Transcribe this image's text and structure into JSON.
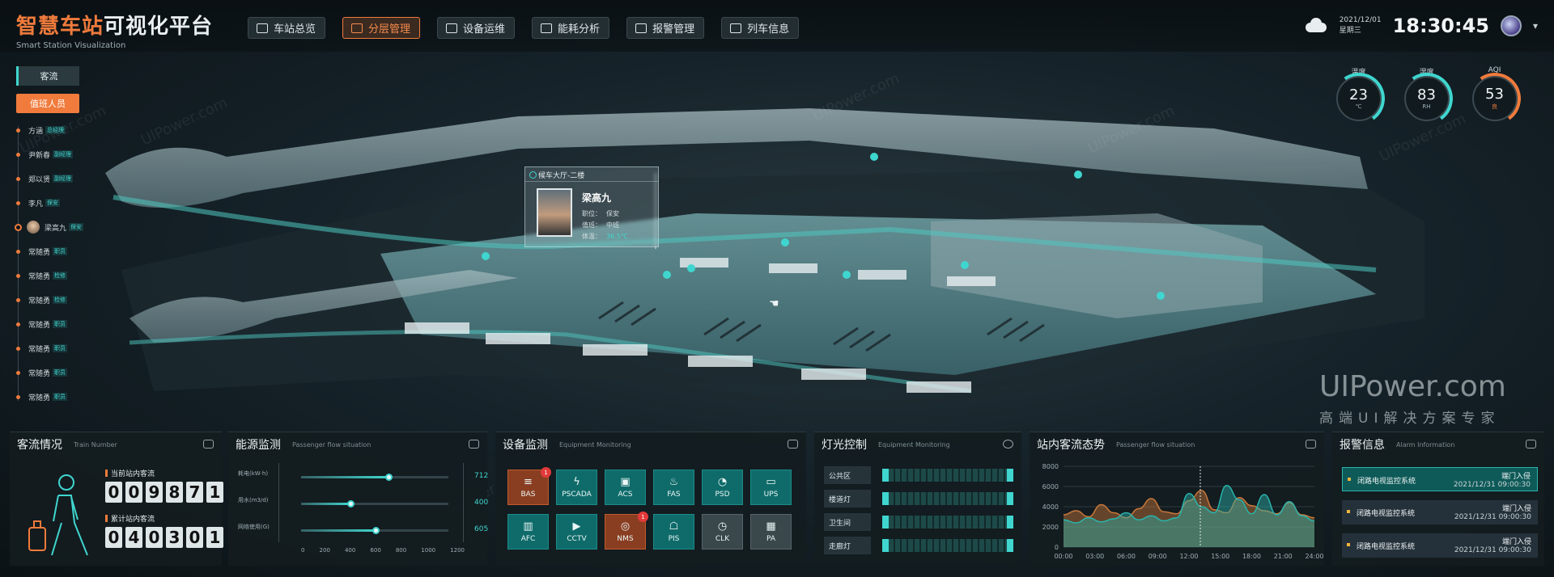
{
  "header": {
    "title_part1": "智慧车站",
    "title_part2": "可视化平台",
    "subtitle": "Smart Station Visualization",
    "nav": [
      {
        "label": "车站总览",
        "active": false
      },
      {
        "label": "分层管理",
        "active": true
      },
      {
        "label": "设备运维",
        "active": false
      },
      {
        "label": "能耗分析",
        "active": false
      },
      {
        "label": "报警管理",
        "active": false
      },
      {
        "label": "列车信息",
        "active": false
      }
    ],
    "date": "2021/12/01",
    "weekday": "星期三",
    "time": "18:30:45"
  },
  "left": {
    "tab_flow": "客流",
    "tab_staff": "值班人员",
    "staff": [
      {
        "name": "方涵",
        "role": "总经理"
      },
      {
        "name": "尹新春",
        "role": "副经理"
      },
      {
        "name": "郑以贤",
        "role": "副经理"
      },
      {
        "name": "李凡",
        "role": "保安"
      },
      {
        "name": "梁高九",
        "role": "保安",
        "selected": true
      },
      {
        "name": "常随勇",
        "role": "职员"
      },
      {
        "name": "常随勇",
        "role": "检修"
      },
      {
        "name": "常随勇",
        "role": "检修"
      },
      {
        "name": "常随勇",
        "role": "职员"
      },
      {
        "name": "常随勇",
        "role": "职员"
      },
      {
        "name": "常随勇",
        "role": "职员"
      },
      {
        "name": "常随勇",
        "role": "职员"
      }
    ]
  },
  "gauges": [
    {
      "label": "温度",
      "value": "23",
      "unit": "℃",
      "kind": "temp"
    },
    {
      "label": "湿度",
      "value": "83",
      "unit": "RH",
      "kind": "hum"
    },
    {
      "label": "AQI",
      "value": "53",
      "unit": "良",
      "kind": "aqi"
    }
  ],
  "popup": {
    "location": "候车大厅-二楼",
    "name": "梁高九",
    "job_label": "职位：",
    "job": "保安",
    "shift_label": "值班：",
    "shift": "中班",
    "temp_label": "体温：",
    "temp": "36.5℃"
  },
  "panels": {
    "flow": {
      "title": "客流情况",
      "en": "Train Number",
      "current_label": "当前站内客流",
      "current_digits": [
        "0",
        "0",
        "9",
        "8",
        "7",
        "1"
      ],
      "total_label": "累计站内客流",
      "total_digits": [
        "0",
        "4",
        "0",
        "3",
        "0",
        "1"
      ]
    },
    "energy": {
      "title": "能源监测",
      "en": "Passenger flow situation",
      "rows": [
        {
          "label": "耗电(kW·h)",
          "value": 712
        },
        {
          "label": "用水(m3/d)",
          "value": 400
        },
        {
          "label": "网络使用(G)",
          "value": 605
        }
      ],
      "axis": [
        "0",
        "200",
        "400",
        "600",
        "800",
        "1000",
        "1200"
      ],
      "axis_max": 1200
    },
    "equipment": {
      "title": "设备监测",
      "en": "Equipment Monitoring",
      "items": [
        {
          "label": "BAS",
          "icon": "layers-icon",
          "glyph": "≡",
          "state": "warn",
          "badge": "1"
        },
        {
          "label": "PSCADA",
          "icon": "bolt-icon",
          "glyph": "ϟ",
          "state": "ok",
          "badge": ""
        },
        {
          "label": "ACS",
          "icon": "door-icon",
          "glyph": "▣",
          "state": "ok",
          "badge": ""
        },
        {
          "label": "FAS",
          "icon": "flame-icon",
          "glyph": "♨",
          "state": "ok",
          "badge": ""
        },
        {
          "label": "PSD",
          "icon": "gauge-icon",
          "glyph": "◔",
          "state": "ok",
          "badge": ""
        },
        {
          "label": "UPS",
          "icon": "battery-icon",
          "glyph": "▭",
          "state": "ok",
          "badge": ""
        },
        {
          "label": "AFC",
          "icon": "gate-icon",
          "glyph": "▥",
          "state": "ok",
          "badge": ""
        },
        {
          "label": "CCTV",
          "icon": "camera-icon",
          "glyph": "▶",
          "state": "ok",
          "badge": ""
        },
        {
          "label": "NMS",
          "icon": "network-icon",
          "glyph": "◎",
          "state": "warn",
          "badge": "1"
        },
        {
          "label": "PIS",
          "icon": "display-icon",
          "glyph": "☖",
          "state": "ok",
          "badge": ""
        },
        {
          "label": "CLK",
          "icon": "clock-icon",
          "glyph": "◷",
          "state": "off",
          "badge": ""
        },
        {
          "label": "PA",
          "icon": "chip-icon",
          "glyph": "▦",
          "state": "off",
          "badge": ""
        }
      ]
    },
    "light": {
      "title": "灯光控制",
      "en": "Equipment Monitoring",
      "zones": [
        "公共区",
        "楼道灯",
        "卫生间",
        "走廊灯"
      ]
    },
    "trend": {
      "title": "站内客流态势",
      "en": "Passenger flow situation"
    },
    "alarm": {
      "title": "报警信息",
      "en": "Alarm Information",
      "rows": [
        {
          "name": "闭路电视监控系统",
          "type": "端门入侵",
          "time": "2021/12/31 09:00:30"
        },
        {
          "name": "闭路电视监控系统",
          "type": "端门入侵",
          "time": "2021/12/31 09:00:30"
        },
        {
          "name": "闭路电视监控系统",
          "type": "端门入侵",
          "time": "2021/12/31 09:00:30"
        }
      ]
    }
  },
  "chart_data": {
    "type": "area",
    "x": [
      "00:00",
      "03:00",
      "06:00",
      "09:00",
      "12:00",
      "15:00",
      "18:00",
      "21:00",
      "24:00"
    ],
    "ylim": [
      0,
      8000
    ],
    "yticks": [
      "0",
      "2000",
      "4000",
      "6000",
      "8000"
    ],
    "series": [
      {
        "color": "#c8773a",
        "values": [
          3200,
          3600,
          3000,
          4200,
          3400,
          2900,
          3800,
          4800,
          3500,
          3300,
          4600,
          5600,
          3700,
          3400,
          4900,
          4100,
          3600,
          3300,
          4400,
          3200,
          2900
        ]
      },
      {
        "color": "#2ab3ac",
        "values": [
          2700,
          2400,
          2900,
          2500,
          2800,
          3400,
          2700,
          3100,
          2600,
          2900,
          5300,
          4000,
          3400,
          6100,
          4700,
          3300,
          5200,
          3200,
          4500,
          3100,
          2600
        ]
      }
    ]
  },
  "watermark": {
    "brand": "UIPower.com",
    "tagline": "高端UI解决方案专家",
    "small": "UIPower.com"
  }
}
